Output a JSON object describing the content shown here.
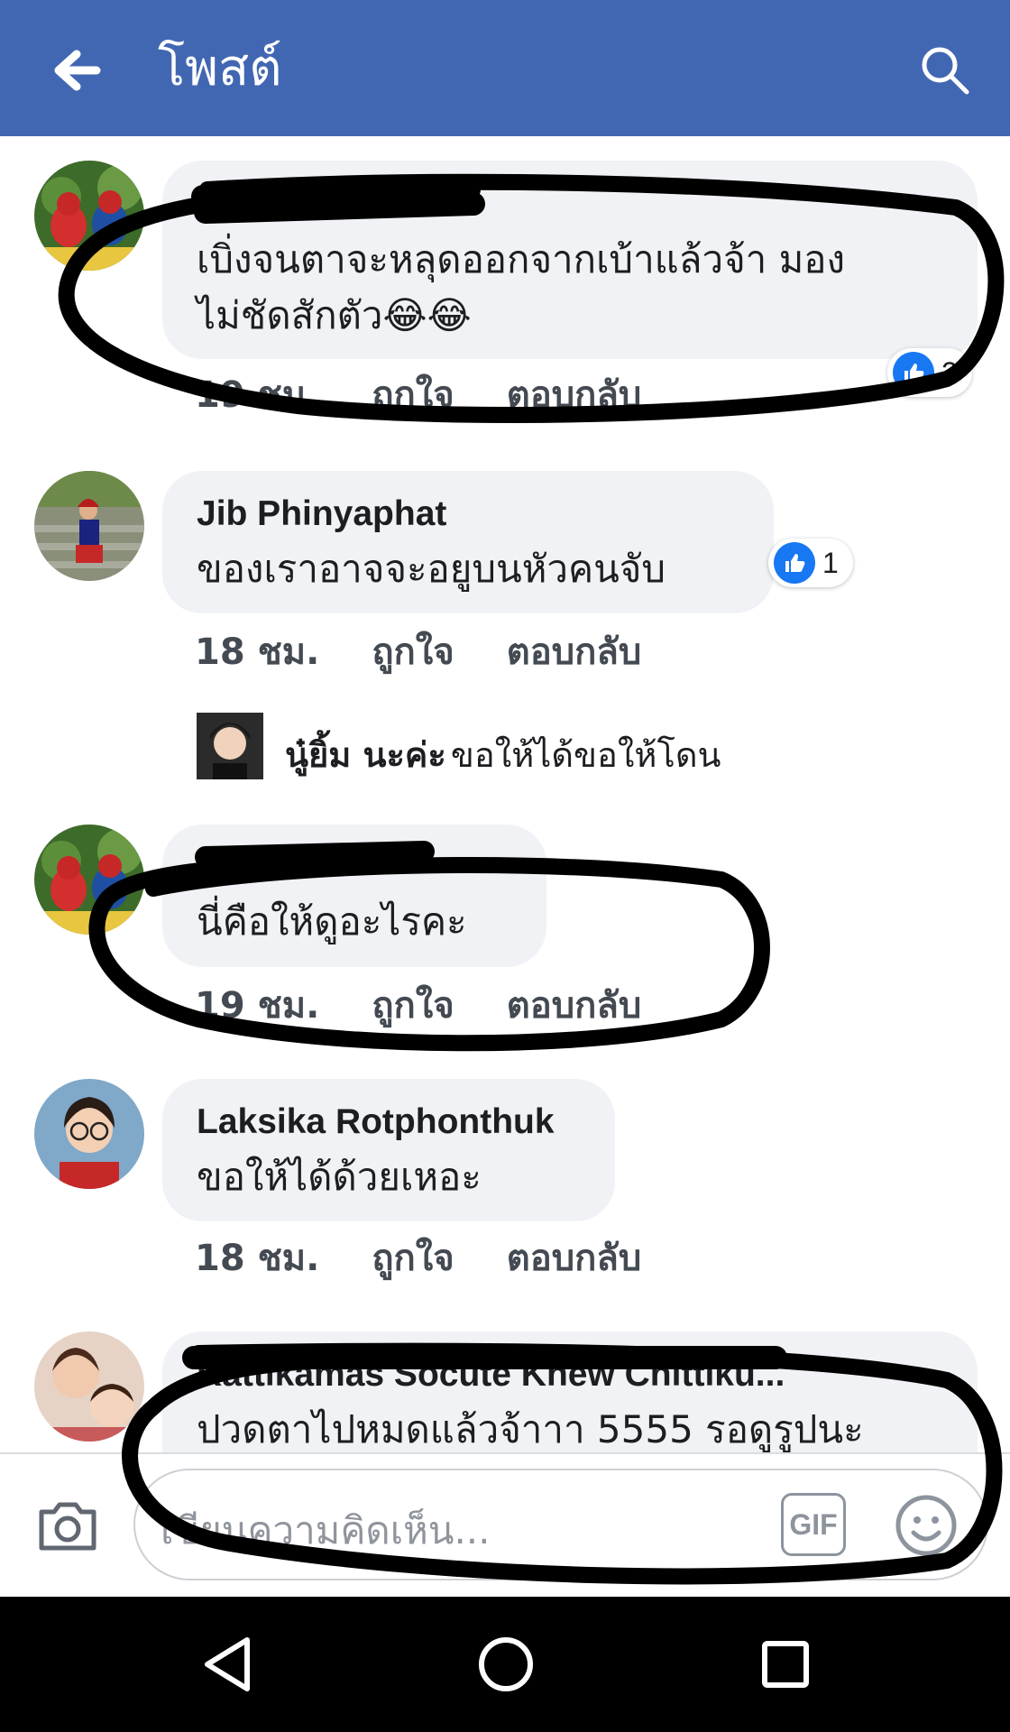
{
  "header": {
    "title": "โพสต์",
    "back_icon": "arrow-left-icon",
    "search_icon": "search-icon",
    "bg_color": "#4267b2"
  },
  "comments": [
    {
      "author": "",
      "text_lines": [
        "เบิ่งจนตาจะหลุดออกจากเบ้าแล้วจ้า มอง",
        "ไม่ชัดสักตัว😂😂"
      ],
      "time": "19 ชม.",
      "like_label": "ถูกใจ",
      "reply_label": "ตอบกลับ",
      "reaction_count": "2"
    },
    {
      "author": "Jib Phinyaphat",
      "text_lines": [
        "ของเราอาจจะอยูบนหัวคนจับ"
      ],
      "time": "18 ชม.",
      "like_label": "ถูกใจ",
      "reply_label": "ตอบกลับ",
      "reaction_count": "1",
      "reply": {
        "name": "นู๋ยิ้ม นะค่ะ",
        "text": "ขอให้ได้ขอให้โดน"
      }
    },
    {
      "author": "",
      "text_lines": [
        "นี่คือให้ดูอะไรคะ"
      ],
      "time": "19 ชม.",
      "like_label": "ถูกใจ",
      "reply_label": "ตอบกลับ"
    },
    {
      "author": "Laksika Rotphonthuk",
      "text_lines": [
        "ขอให้ได้ด้วยเหอะ"
      ],
      "time": "18 ชม.",
      "like_label": "ถูกใจ",
      "reply_label": "ตอบกลับ"
    },
    {
      "author": "Kattikamas Socute Khew Chittiku...",
      "text_lines": [
        "ปวดตาไปหมดแล้วจ้าาา 5555 รอดูรูปนะ"
      ]
    }
  ],
  "composer": {
    "placeholder": "เขียนความคิดเห็น...",
    "gif_label": "GIF",
    "camera_icon": "camera-icon",
    "sticker_icon": "smiley-icon"
  },
  "android_nav": {
    "back_icon": "triangle-back-icon",
    "home_icon": "circle-home-icon",
    "recents_icon": "square-recents-icon"
  }
}
